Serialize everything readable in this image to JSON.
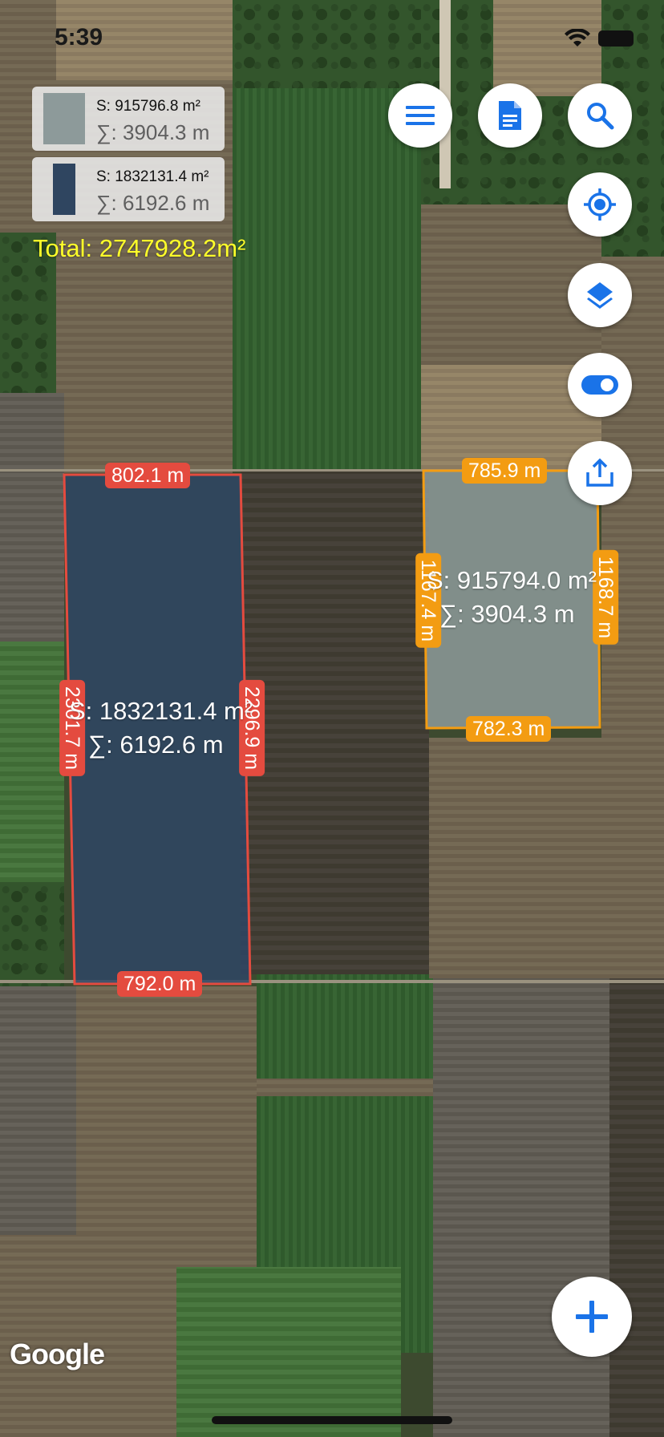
{
  "status": {
    "time": "5:39"
  },
  "cards": [
    {
      "area": "S: 915796.8 m²",
      "perimeter": "∑: 3904.3 m",
      "color": "#8d9a9a"
    },
    {
      "area": "S: 1832131.4 m²",
      "perimeter": "∑: 6192.6 m",
      "color": "#2f4560"
    }
  ],
  "total": "Total: 2747928.2m²",
  "red_polygon": {
    "area": "S: 1832131.4 m²",
    "perimeter": "∑: 6192.6 m",
    "top": "802.1 m",
    "bottom": "792.0 m",
    "left": "2301.7 m",
    "right": "2296.9 m",
    "stroke": "#e44b3f",
    "fill": "#2d4566"
  },
  "orange_polygon": {
    "area": "S: 915794.0 m²",
    "perimeter": "∑: 3904.3 m",
    "top": "785.9 m",
    "bottom": "782.3 m",
    "left": "1167.4 m",
    "right": "1168.7 m",
    "stroke": "#f39c12",
    "fill": "#8d9a9a"
  },
  "buttons": {
    "menu": "menu-icon",
    "document": "document-icon",
    "search": "search-icon",
    "location": "my-location-icon",
    "layers": "layers-icon",
    "toggle": "toggle-icon",
    "share": "share-icon",
    "add": "add-icon"
  },
  "accent": "#1a73e8",
  "attribution": "Google"
}
